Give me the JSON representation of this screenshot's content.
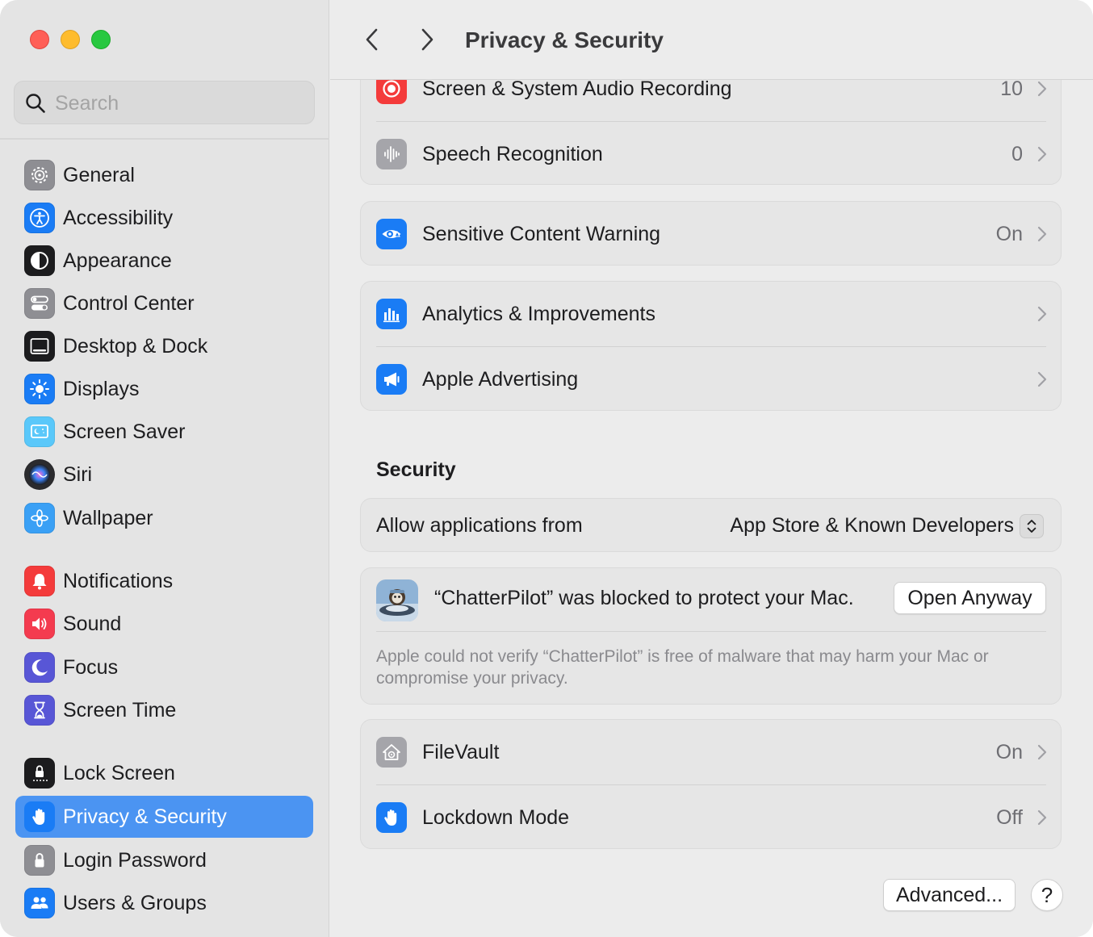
{
  "window": {
    "title": "Privacy & Security"
  },
  "search": {
    "placeholder": "Search"
  },
  "sidebar": {
    "items": [
      {
        "label": "General",
        "icon": "gear-icon",
        "color": "#8e8e93"
      },
      {
        "label": "Accessibility",
        "icon": "accessibility-icon",
        "color": "#1a7cf5"
      },
      {
        "label": "Appearance",
        "icon": "appearance-icon",
        "color": "#1c1c1e"
      },
      {
        "label": "Control Center",
        "icon": "control-center-icon",
        "color": "#8e8e93"
      },
      {
        "label": "Desktop & Dock",
        "icon": "desktop-dock-icon",
        "color": "#1c1c1e"
      },
      {
        "label": "Displays",
        "icon": "displays-icon",
        "color": "#1a7cf5"
      },
      {
        "label": "Screen Saver",
        "icon": "screen-saver-icon",
        "color": "#5ac8fa"
      },
      {
        "label": "Siri",
        "icon": "siri-icon",
        "color": "#2b2b2e"
      },
      {
        "label": "Wallpaper",
        "icon": "wallpaper-icon",
        "color": "#3aa0f5"
      },
      {
        "label": "Notifications",
        "icon": "notifications-icon",
        "color": "#f43b3b"
      },
      {
        "label": "Sound",
        "icon": "sound-icon",
        "color": "#f43b4f"
      },
      {
        "label": "Focus",
        "icon": "focus-icon",
        "color": "#5856d6"
      },
      {
        "label": "Screen Time",
        "icon": "screen-time-icon",
        "color": "#5856d6"
      },
      {
        "label": "Lock Screen",
        "icon": "lock-screen-icon",
        "color": "#1c1c1e"
      },
      {
        "label": "Privacy & Security",
        "icon": "privacy-hand-icon",
        "color": "#1a7cf5",
        "selected": true
      },
      {
        "label": "Login Password",
        "icon": "login-password-icon",
        "color": "#8e8e93"
      },
      {
        "label": "Users & Groups",
        "icon": "users-groups-icon",
        "color": "#1a7cf5"
      }
    ]
  },
  "privacy_rows": [
    {
      "label": "Screen & System Audio Recording",
      "value": "10",
      "icon": "screen-recording-icon"
    },
    {
      "label": "Speech Recognition",
      "value": "0",
      "icon": "speech-recognition-icon"
    },
    {
      "label": "Sensitive Content Warning",
      "value": "On",
      "icon": "sensitive-content-icon"
    },
    {
      "label": "Analytics & Improvements",
      "value": "",
      "icon": "analytics-icon"
    },
    {
      "label": "Apple Advertising",
      "value": "",
      "icon": "advertising-icon"
    }
  ],
  "security": {
    "title": "Security",
    "allow_label": "Allow applications from",
    "allow_value": "App Store & Known Developers",
    "blocked_text": "“ChatterPilot” was blocked to protect your Mac.",
    "open_anyway": "Open Anyway",
    "blocked_description": "Apple could not verify “ChatterPilot” is free of malware that may harm your Mac or compromise your privacy.",
    "filevault_label": "FileVault",
    "filevault_value": "On",
    "lockdown_label": "Lockdown Mode",
    "lockdown_value": "Off"
  },
  "footer": {
    "advanced": "Advanced...",
    "help": "?"
  },
  "colors": {
    "accent": "#4b94f2",
    "selected_row": "#4b94f2"
  }
}
